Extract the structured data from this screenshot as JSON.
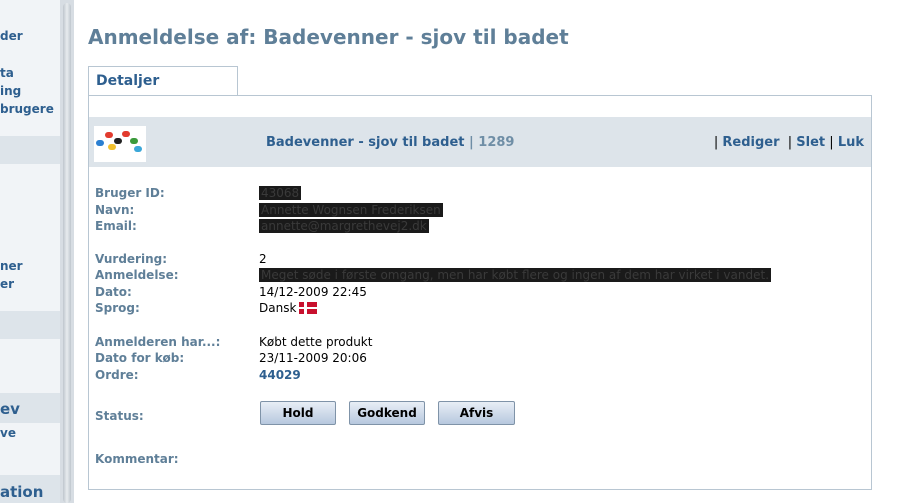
{
  "sidebar": {
    "items": [
      "der",
      "ta",
      "ing",
      "brugere",
      "ner",
      "er",
      "ve"
    ],
    "headers": [
      "ev",
      "ation"
    ]
  },
  "page": {
    "title": "Anmeldelse af: Badevenner - sjov til badet"
  },
  "tab": {
    "label": "Detaljer"
  },
  "product": {
    "name": "Badevenner - sjov til badet",
    "separator": " | ",
    "id": "1289",
    "thumbnail_icon": "product-toy-icon"
  },
  "actions": {
    "edit": "Rediger",
    "delete": "Slet",
    "close": "Luk"
  },
  "details": {
    "user_id": {
      "label": "Bruger ID:",
      "value": "43068"
    },
    "name": {
      "label": "Navn:",
      "value": "Annette Wognsen Frederiksen"
    },
    "email": {
      "label": "Email:",
      "value": "annette@margrethevej2.dk"
    },
    "rating": {
      "label": "Vurdering:",
      "value": "2"
    },
    "review": {
      "label": "Anmeldelse:",
      "value": "Meget søde i første omgang, men har købt flere og ingen af dem har virket i vandet."
    },
    "date": {
      "label": "Dato:",
      "value": "14/12-2009 22:45"
    },
    "language": {
      "label": "Sprog:",
      "value": "Dansk",
      "flag_icon": "danish-flag-icon"
    },
    "reviewer_has": {
      "label": "Anmelderen har...:",
      "value": "Købt dette produkt"
    },
    "purchase_date": {
      "label": "Dato for køb:",
      "value": "23/11-2009 20:06"
    },
    "order": {
      "label": "Ordre:",
      "value": "44029"
    },
    "status": {
      "label": "Status:"
    },
    "comment": {
      "label": "Kommentar:"
    }
  },
  "buttons": {
    "hold": "Hold",
    "approve": "Godkend",
    "reject": "Afvis"
  }
}
